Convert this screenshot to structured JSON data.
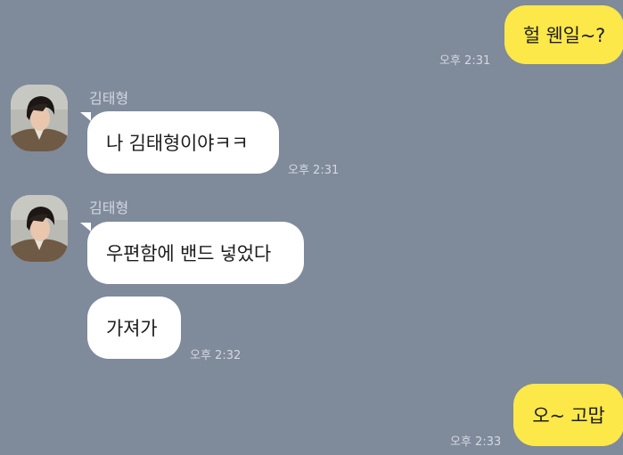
{
  "chat": {
    "messages": [
      {
        "id": "m1",
        "from": "me",
        "text": "헐 웬일~?",
        "time": "오후 2:31"
      },
      {
        "id": "m2",
        "from": "friend",
        "sender": "김태형",
        "text": "나 김태형이야ㅋㅋ",
        "time": "오후 2:31"
      },
      {
        "id": "m3",
        "from": "friend",
        "sender": "김태형",
        "text": "우편함에 밴드 넣었다"
      },
      {
        "id": "m4",
        "from": "friend",
        "text": "가져가",
        "time": "오후 2:32"
      },
      {
        "id": "m5",
        "from": "me",
        "text": "오~ 고맙",
        "time": "오후 2:33"
      }
    ]
  },
  "colors": {
    "background": "#7f8a9b",
    "my_bubble": "#fde84a",
    "their_bubble": "#ffffff"
  }
}
